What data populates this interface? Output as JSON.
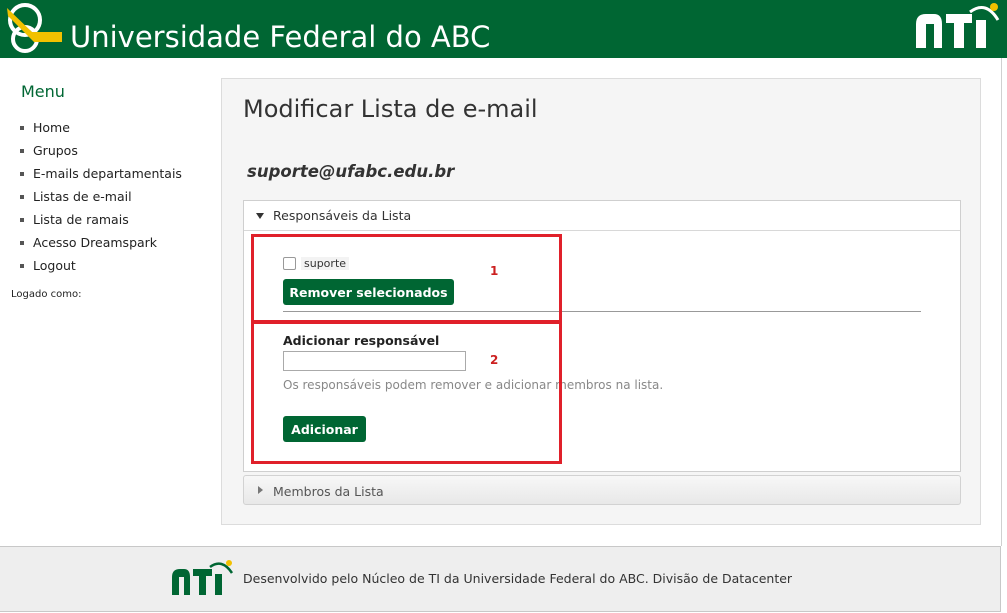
{
  "header": {
    "title": "Universidade Federal do ABC",
    "brand_color": "#006633",
    "logo_icon": "ufabc-logo-icon",
    "nti_icon": "nti-logo-icon"
  },
  "sidebar": {
    "menu_title": "Menu",
    "items": [
      {
        "label": "Home"
      },
      {
        "label": "Grupos"
      },
      {
        "label": "E-mails departamentais"
      },
      {
        "label": "Listas de e-mail"
      },
      {
        "label": "Lista de ramais"
      },
      {
        "label": "Acesso Dreamspark"
      },
      {
        "label": "Logout"
      }
    ],
    "logged_as": "Logado como:"
  },
  "main": {
    "page_title": "Modificar Lista de e-mail",
    "list_email": "suporte@ufabc.edu.br",
    "owners_section": {
      "label": "Responsáveis da Lista",
      "expanded": true,
      "owners": [
        {
          "name": "suporte",
          "checked": false
        }
      ],
      "remove_button": "Remover selecionados",
      "add_label": "Adicionar responsável",
      "add_input_value": "",
      "add_input_placeholder": "",
      "help_text": "Os responsáveis podem remover e adicionar membros na lista.",
      "add_button": "Adicionar"
    },
    "members_section": {
      "label": "Membros da Lista",
      "expanded": false
    },
    "annotations": [
      {
        "number": "1"
      },
      {
        "number": "2"
      }
    ],
    "annotation_color": "#e0202a"
  },
  "footer": {
    "text": "Desenvolvido pelo Núcleo de TI da Universidade Federal do ABC. Divisão de Datacenter"
  }
}
